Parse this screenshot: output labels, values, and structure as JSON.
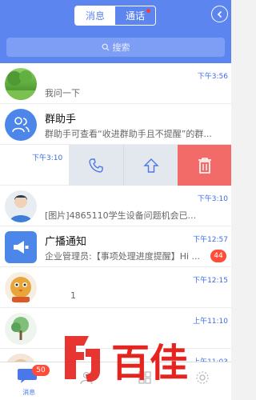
{
  "header": {
    "tab_messages": "消息",
    "tab_calls": "通话",
    "search_placeholder": "搜索"
  },
  "rows": [
    {
      "title": "",
      "subtitle": "我问一下",
      "time": "下午3:56"
    },
    {
      "title": "群助手",
      "subtitle": "群助手可查看“收进群助手且不提醒”的群...",
      "time": ""
    },
    {
      "title": "",
      "subtitle": "",
      "time": "下午3:10"
    },
    {
      "title": "",
      "subtitle": "[图片]4865110学生设备问题机会已...",
      "time": "下午3:10"
    },
    {
      "title": "广播通知",
      "subtitle": "企业管理员:【事项处理进度提醒】Hi ...",
      "time": "下午12:57",
      "badge": "44"
    },
    {
      "title": "",
      "subtitle": "1",
      "time": "下午12:15"
    },
    {
      "title": "",
      "subtitle": "",
      "time": "上午11:10"
    },
    {
      "title": "",
      "subtitle": "",
      "time": "上午11:03"
    }
  ],
  "tabbar": {
    "messages_label": "消息",
    "messages_badge": "50"
  },
  "watermark_text": "百佳"
}
